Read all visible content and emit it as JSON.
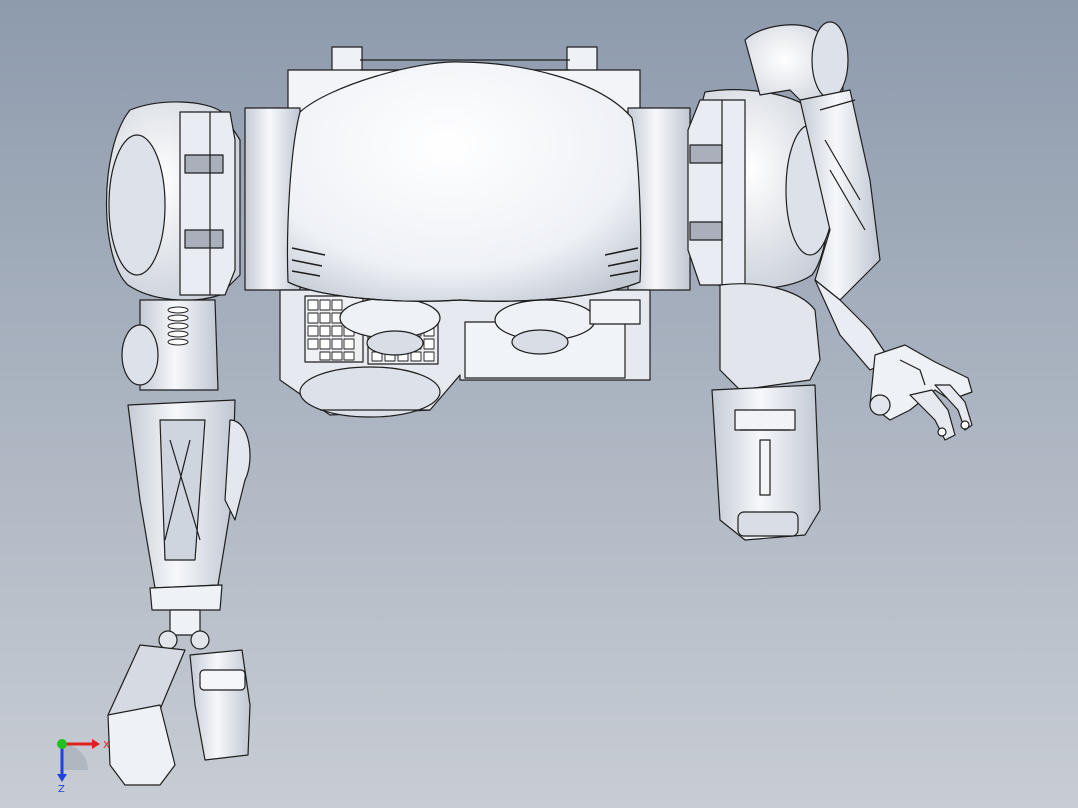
{
  "viewport": {
    "background_top": "#8e9bad",
    "background_bottom": "#c8cdd4"
  },
  "model": {
    "part_color": "#e8ecf2",
    "shade_color": "#b9c0cc",
    "edge_color": "#1e1e1e"
  },
  "triad": {
    "x_label": "X",
    "z_label": "Z",
    "x_color": "#e02020",
    "y_color": "#20c020",
    "z_color": "#2040e0"
  }
}
